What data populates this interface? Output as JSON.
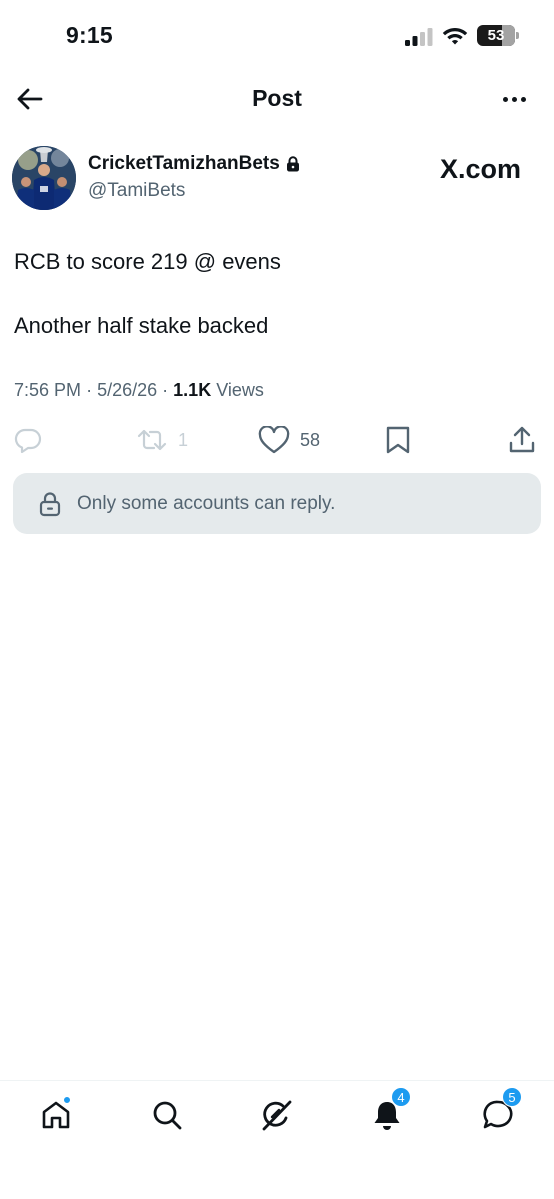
{
  "status_bar": {
    "time": "9:15",
    "battery": "53"
  },
  "header": {
    "title": "Post",
    "back_icon": "arrow-left-icon",
    "more_icon": "more-dots-icon"
  },
  "author": {
    "name": "CricketTamizhanBets",
    "handle": "@TamiBets",
    "protected": true,
    "avatar_icon": "avatar-photo"
  },
  "watermark": {
    "text": "X.com"
  },
  "post": {
    "lines": [
      "RCB to score 219 @ evens",
      "Another half stake backed"
    ],
    "time": "7:56 PM",
    "separator": "·",
    "date": "5/26/26",
    "views_count": "1.1K",
    "views_label": "Views"
  },
  "actions": {
    "reply": {
      "icon": "reply-icon",
      "count": ""
    },
    "repost": {
      "icon": "repost-icon",
      "count": "1"
    },
    "like": {
      "icon": "heart-icon",
      "count": "58"
    },
    "bookmark": {
      "icon": "bookmark-icon"
    },
    "share": {
      "icon": "share-icon"
    }
  },
  "reply_restriction": {
    "icon": "lock-icon",
    "text": "Only some accounts can reply."
  },
  "tabbar": {
    "home": {
      "icon": "home-icon",
      "has_dot": true
    },
    "search": {
      "icon": "search-icon"
    },
    "grok": {
      "icon": "grok-icon"
    },
    "notifications": {
      "icon": "bell-icon",
      "badge": "4"
    },
    "messages": {
      "icon": "message-icon",
      "badge": "5"
    }
  },
  "colors": {
    "text": "#0f1419",
    "secondary": "#536471",
    "accent": "#1d9bf0",
    "restriction_bg": "#e5eaec"
  }
}
